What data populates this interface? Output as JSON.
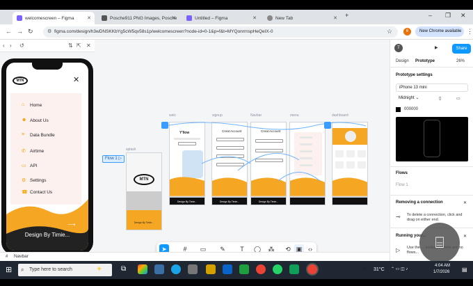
{
  "browser": {
    "tabs": [
      {
        "label": "welcomescreen – Figma",
        "color": "#7b61ff"
      },
      {
        "label": "Posche911 PNG Images, Posche",
        "color": "#555555"
      },
      {
        "label": "Untitled – Figma",
        "color": "#7b61ff"
      },
      {
        "label": "New Tab",
        "color": "#888888"
      }
    ],
    "url": "figma.com/design/h3wDNSKKbYg5cW5qv58s1p/welcomescreen?node-id=0-1&p=f&t=MYQonrrnspHeQeIX-0",
    "new_chrome_label": "New Chrome available",
    "profile_initial": "6"
  },
  "prototype_preview": {
    "menu_items": [
      "Home",
      "About Us",
      "Data Bundle",
      "Airtime",
      "API",
      "Settings",
      "Contact Us"
    ],
    "logo_text": "MTN",
    "footer_text": "Design By Timie...",
    "flow_label": "Flow 1"
  },
  "frames": {
    "labels": [
      "splash",
      "welc",
      "signup",
      "Navbar",
      "menu",
      "dashboard"
    ],
    "splash_footer": "Design By Timie...",
    "welcome_title": "Y'llow",
    "create_account": "Creat Account",
    "footer": "Design By Timie..."
  },
  "bottom_label": "Navbar",
  "right_panel": {
    "tab_design": "Design",
    "tab_prototype": "Prototype",
    "zoom": "26%",
    "share": "Share",
    "avatar": "T",
    "section_settings": "Prototype settings",
    "device": "iPhone 13 mini",
    "theme": "Midnight",
    "color_hex": "000000",
    "section_flows": "Flows",
    "flow_item": "Flow 1",
    "section_remove": "Removing a connection",
    "remove_text": "To delete a connection, click and drag on either end.",
    "section_running": "Running your...",
    "running_text": "Use the ... toolbar ... there are no flows..."
  },
  "taskbar": {
    "search_placeholder": "Type here to search",
    "temperature": "31°C",
    "time": "4:04 AM",
    "date": "1/7/2026"
  }
}
